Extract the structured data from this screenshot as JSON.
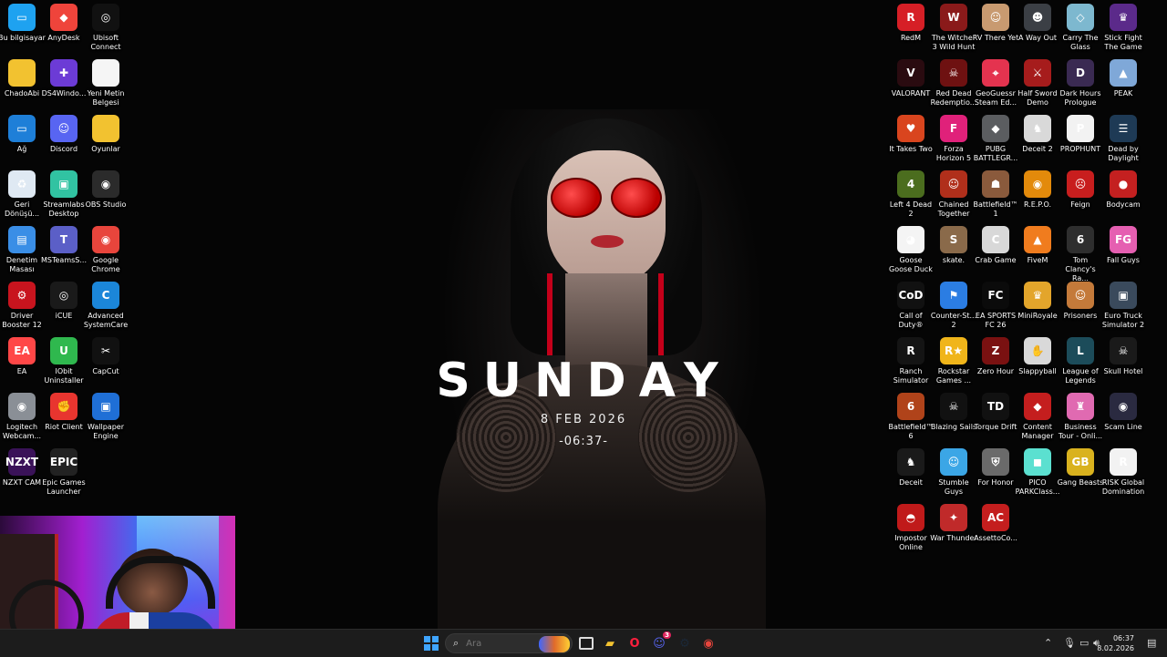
{
  "wallpaper": {
    "day": "SUNDAY",
    "date": "8 FEB 2026",
    "time": "-06:37-"
  },
  "desktop_icons_left": [
    {
      "label": "Bu bilgisayar",
      "icon": "computer-icon",
      "color": "#1ea2f0",
      "glyph": "▭"
    },
    {
      "label": "AnyDesk",
      "icon": "anydesk-icon",
      "color": "#ef443b",
      "glyph": "◆"
    },
    {
      "label": "Ubisoft Connect",
      "icon": "ubisoft-icon",
      "color": "#111111",
      "glyph": "◎"
    },
    {
      "label": "ChadoAbi",
      "icon": "folder-icon",
      "color": "#f2c230",
      "glyph": ""
    },
    {
      "label": "DS4Windo...",
      "icon": "gamepad-icon",
      "color": "#6c3bd6",
      "glyph": "✚"
    },
    {
      "label": "Yeni Metin Belgesi",
      "icon": "text-file-icon",
      "color": "#f5f5f5",
      "glyph": ""
    },
    {
      "label": "Ağ",
      "icon": "network-icon",
      "color": "#1e7fd8",
      "glyph": "▭"
    },
    {
      "label": "Discord",
      "icon": "discord-icon",
      "color": "#5865f2",
      "glyph": "☺"
    },
    {
      "label": "Oyunlar",
      "icon": "folder-icon",
      "color": "#f2c230",
      "glyph": ""
    },
    {
      "label": "Geri Dönüşü...",
      "icon": "recycle-bin-icon",
      "color": "#dfe9f3",
      "glyph": "♻"
    },
    {
      "label": "Streamlabs Desktop",
      "icon": "streamlabs-icon",
      "color": "#31c3a2",
      "glyph": "▣"
    },
    {
      "label": "OBS Studio",
      "icon": "obs-icon",
      "color": "#2b2b2b",
      "glyph": "◉"
    },
    {
      "label": "Denetim Masası",
      "icon": "control-panel-icon",
      "color": "#3a8ee6",
      "glyph": "▤"
    },
    {
      "label": "MSTeamsS...",
      "icon": "teams-icon",
      "color": "#5b5fc7",
      "glyph": "T"
    },
    {
      "label": "Google Chrome",
      "icon": "chrome-icon",
      "color": "#e8453c",
      "glyph": "◉"
    },
    {
      "label": "Driver Booster 12",
      "icon": "driver-booster-icon",
      "color": "#c8141e",
      "glyph": "⚙"
    },
    {
      "label": "iCUE",
      "icon": "icue-icon",
      "color": "#1a1a1a",
      "glyph": "◎"
    },
    {
      "label": "Advanced SystemCare",
      "icon": "systemcare-icon",
      "color": "#1b86d9",
      "glyph": "C"
    },
    {
      "label": "EA",
      "icon": "ea-icon",
      "color": "#ff4747",
      "glyph": "EA"
    },
    {
      "label": "IObit Uninstaller",
      "icon": "iobit-icon",
      "color": "#2fb84e",
      "glyph": "U"
    },
    {
      "label": "CapCut",
      "icon": "capcut-icon",
      "color": "#111111",
      "glyph": "✂"
    },
    {
      "label": "Logitech Webcam...",
      "icon": "webcam-icon",
      "color": "#8a8f96",
      "glyph": "◉"
    },
    {
      "label": "Riot Client",
      "icon": "riot-icon",
      "color": "#e8352f",
      "glyph": "✊"
    },
    {
      "label": "Wallpaper Engine",
      "icon": "wallpaper-engine-icon",
      "color": "#1f6fd6",
      "glyph": "▣"
    },
    {
      "label": "NZXT CAM",
      "icon": "nzxt-icon",
      "color": "#3a1258",
      "glyph": "NZXT"
    },
    {
      "label": "Epic Games Launcher",
      "icon": "epic-icon",
      "color": "#222222",
      "glyph": "EPIC"
    }
  ],
  "desktop_icons_right": [
    {
      "label": "RedM",
      "icon": "redm-icon",
      "color": "#d61f26",
      "glyph": "R"
    },
    {
      "label": "The Witcher 3 Wild Hunt",
      "icon": "witcher-icon",
      "color": "#8a1a1a",
      "glyph": "W"
    },
    {
      "label": "RV There Yet",
      "icon": "rv-there-yet-icon",
      "color": "#c89a70",
      "glyph": "☺"
    },
    {
      "label": "A Way Out",
      "icon": "a-way-out-icon",
      "color": "#3b3f45",
      "glyph": "☻"
    },
    {
      "label": "Carry The Glass",
      "icon": "carry-the-glass-icon",
      "color": "#7db8cf",
      "glyph": "◇"
    },
    {
      "label": "Stick Fight The Game",
      "icon": "stick-fight-icon",
      "color": "#5b2a8a",
      "glyph": "♛"
    },
    {
      "label": "VALORANT",
      "icon": "valorant-icon",
      "color": "#2a0b10",
      "glyph": "V"
    },
    {
      "label": "Red Dead Redemptio...",
      "icon": "rdr-icon",
      "color": "#6e1111",
      "glyph": "☠"
    },
    {
      "label": "GeoGuessr Steam Ed...",
      "icon": "geoguessr-icon",
      "color": "#e4334f",
      "glyph": "⌖"
    },
    {
      "label": "Half Sword Demo",
      "icon": "half-sword-icon",
      "color": "#a61c1c",
      "glyph": "⚔"
    },
    {
      "label": "Dark Hours Prologue",
      "icon": "dark-hours-icon",
      "color": "#3a2a52",
      "glyph": "D"
    },
    {
      "label": "PEAK",
      "icon": "peak-icon",
      "color": "#7fa8d8",
      "glyph": "▲"
    },
    {
      "label": "It Takes Two",
      "icon": "it-takes-two-icon",
      "color": "#d9451e",
      "glyph": "♥"
    },
    {
      "label": "Forza Horizon 5",
      "icon": "forza-icon",
      "color": "#e0217a",
      "glyph": "F"
    },
    {
      "label": "PUBG BATTLEGR...",
      "icon": "pubg-icon",
      "color": "#5b5d60",
      "glyph": "◆"
    },
    {
      "label": "Deceit 2",
      "icon": "deceit-2-icon",
      "color": "#d9d9d9",
      "glyph": "♞"
    },
    {
      "label": "PROPHUNT",
      "icon": "prophunt-icon",
      "color": "#f2f2f2",
      "glyph": "P"
    },
    {
      "label": "Dead by Daylight",
      "icon": "dbd-icon",
      "color": "#1e3a55",
      "glyph": "☰"
    },
    {
      "label": "Left 4 Dead 2",
      "icon": "l4d2-icon",
      "color": "#4b6d1e",
      "glyph": "4"
    },
    {
      "label": "Chained Together",
      "icon": "chained-together-icon",
      "color": "#b02f1b",
      "glyph": "☺"
    },
    {
      "label": "Battlefield™ 1",
      "icon": "battlefield-1-icon",
      "color": "#8a5a3c",
      "glyph": "☗"
    },
    {
      "label": "R.E.P.O.",
      "icon": "repo-icon",
      "color": "#e38a0b",
      "glyph": "◉"
    },
    {
      "label": "Feign",
      "icon": "feign-icon",
      "color": "#c81e1e",
      "glyph": "☹"
    },
    {
      "label": "Bodycam",
      "icon": "bodycam-icon",
      "color": "#c42020",
      "glyph": "●"
    },
    {
      "label": "Goose Goose Duck",
      "icon": "ggd-icon",
      "color": "#f4f4f4",
      "glyph": "◕"
    },
    {
      "label": "skate.",
      "icon": "skate-icon",
      "color": "#8a6a4a",
      "glyph": "S"
    },
    {
      "label": "Crab Game",
      "icon": "crab-game-icon",
      "color": "#d8d8d8",
      "glyph": "C"
    },
    {
      "label": "FiveM",
      "icon": "fivem-icon",
      "color": "#f07c1e",
      "glyph": "▲"
    },
    {
      "label": "Tom Clancy's Ra...",
      "icon": "rainbow-six-icon",
      "color": "#2e2e2e",
      "glyph": "6"
    },
    {
      "label": "Fall Guys",
      "icon": "fall-guys-icon",
      "color": "#e55fb1",
      "glyph": "FG"
    },
    {
      "label": "Call of Duty®",
      "icon": "cod-icon",
      "color": "#111111",
      "glyph": "CoD"
    },
    {
      "label": "Counter-St... 2",
      "icon": "cs2-icon",
      "color": "#2b7de3",
      "glyph": "⚑"
    },
    {
      "label": "EA SPORTS FC 26",
      "icon": "fc26-icon",
      "color": "#0b0b0b",
      "glyph": "FC"
    },
    {
      "label": "MiniRoyale",
      "icon": "miniroyale-icon",
      "color": "#e3a52b",
      "glyph": "♛"
    },
    {
      "label": "Prisoners",
      "icon": "prisoners-icon",
      "color": "#c47a3a",
      "glyph": "☺"
    },
    {
      "label": "Euro Truck Simulator 2",
      "icon": "ets2-icon",
      "color": "#3a4a5c",
      "glyph": "▣"
    },
    {
      "label": "Ranch Simulator",
      "icon": "ranch-icon",
      "color": "#141414",
      "glyph": "R"
    },
    {
      "label": "Rockstar Games ...",
      "icon": "rockstar-icon",
      "color": "#f0b51a",
      "glyph": "R★"
    },
    {
      "label": "Zero Hour",
      "icon": "zero-hour-icon",
      "color": "#7a1111",
      "glyph": "Z"
    },
    {
      "label": "Slappyball",
      "icon": "slappyball-icon",
      "color": "#d9d9d9",
      "glyph": "✋"
    },
    {
      "label": "League of Legends",
      "icon": "lol-icon",
      "color": "#1c4c5a",
      "glyph": "L"
    },
    {
      "label": "Skull Hotel",
      "icon": "skull-hotel-icon",
      "color": "#1a1a1a",
      "glyph": "☠"
    },
    {
      "label": "Battlefield™ 6",
      "icon": "battlefield-6-icon",
      "color": "#b0431a",
      "glyph": "6"
    },
    {
      "label": "Blazing Sails",
      "icon": "blazing-sails-icon",
      "color": "#111111",
      "glyph": "☠"
    },
    {
      "label": "Torque Drift",
      "icon": "torque-drift-icon",
      "color": "#111111",
      "glyph": "TD"
    },
    {
      "label": "Content Manager",
      "icon": "content-manager-icon",
      "color": "#c41e1e",
      "glyph": "◆"
    },
    {
      "label": "Business Tour - Onli...",
      "icon": "business-tour-icon",
      "color": "#e06ab1",
      "glyph": "♜"
    },
    {
      "label": "Scam Line",
      "icon": "scam-line-icon",
      "color": "#2a2a40",
      "glyph": "◉"
    },
    {
      "label": "Deceit",
      "icon": "deceit-icon",
      "color": "#1a1a1a",
      "glyph": "♞"
    },
    {
      "label": "Stumble Guys",
      "icon": "stumble-guys-icon",
      "color": "#3ba6e6",
      "glyph": "☺"
    },
    {
      "label": "For Honor",
      "icon": "for-honor-icon",
      "color": "#6a6a6a",
      "glyph": "⛨"
    },
    {
      "label": "PICO PARKClass...",
      "icon": "pico-park-icon",
      "color": "#5be0d0",
      "glyph": "◼"
    },
    {
      "label": "Gang Beasts",
      "icon": "gang-beasts-icon",
      "color": "#d9b21e",
      "glyph": "GB"
    },
    {
      "label": "RISK Global Domination",
      "icon": "risk-icon",
      "color": "#f2f2f2",
      "glyph": "R"
    },
    {
      "label": "Impostor Online",
      "icon": "impostor-icon",
      "color": "#c01a1a",
      "glyph": "◓"
    },
    {
      "label": "War Thunder",
      "icon": "war-thunder-icon",
      "color": "#c02a2a",
      "glyph": "✦"
    },
    {
      "label": "AssettoCo...",
      "icon": "assetto-corsa-icon",
      "color": "#c41e1e",
      "glyph": "AC"
    }
  ],
  "taskbar": {
    "search_placeholder": "Ara",
    "pinned": [
      {
        "name": "file-explorer-icon",
        "color": "#f2c230",
        "glyph": "▰"
      },
      {
        "name": "opera-gx-icon",
        "color": "#ff1f3d",
        "glyph": "O"
      },
      {
        "name": "discord-taskbar-icon",
        "color": "#5865f2",
        "glyph": "☺",
        "badge": "3"
      },
      {
        "name": "steam-icon",
        "color": "#1b2838",
        "glyph": "⚙"
      },
      {
        "name": "chrome-taskbar-icon",
        "color": "#e8453c",
        "glyph": "◉"
      }
    ],
    "clock_time": "06:37",
    "clock_date": "8.02.2026"
  }
}
